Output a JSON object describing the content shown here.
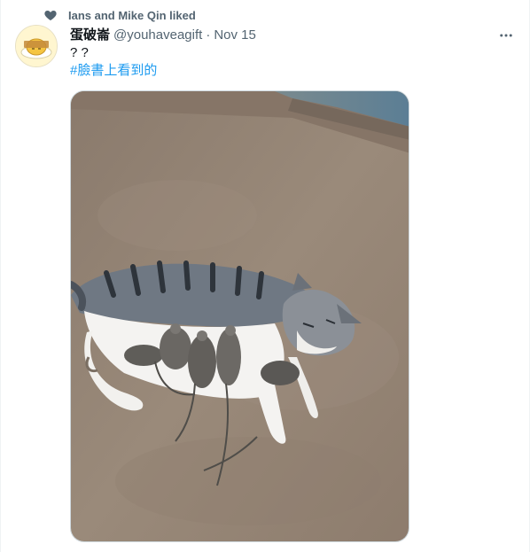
{
  "social_context": {
    "icon": "heart-icon",
    "text": "Ians and Mike Qin liked"
  },
  "tweet": {
    "display_name": "蛋破崙",
    "handle": "@youhaveagift",
    "separator": "·",
    "time": "Nov 15",
    "text": "? ?",
    "hashtag": "#臉書上看到的",
    "more_icon": "more-horizontal-icon",
    "avatar_icon": "gudetama-avatar"
  },
  "media": {
    "description_icon": "cat-with-rats-photo"
  },
  "colors": {
    "link": "#1d9bf0",
    "secondary_text": "#536471",
    "primary_text": "#0f1419"
  }
}
